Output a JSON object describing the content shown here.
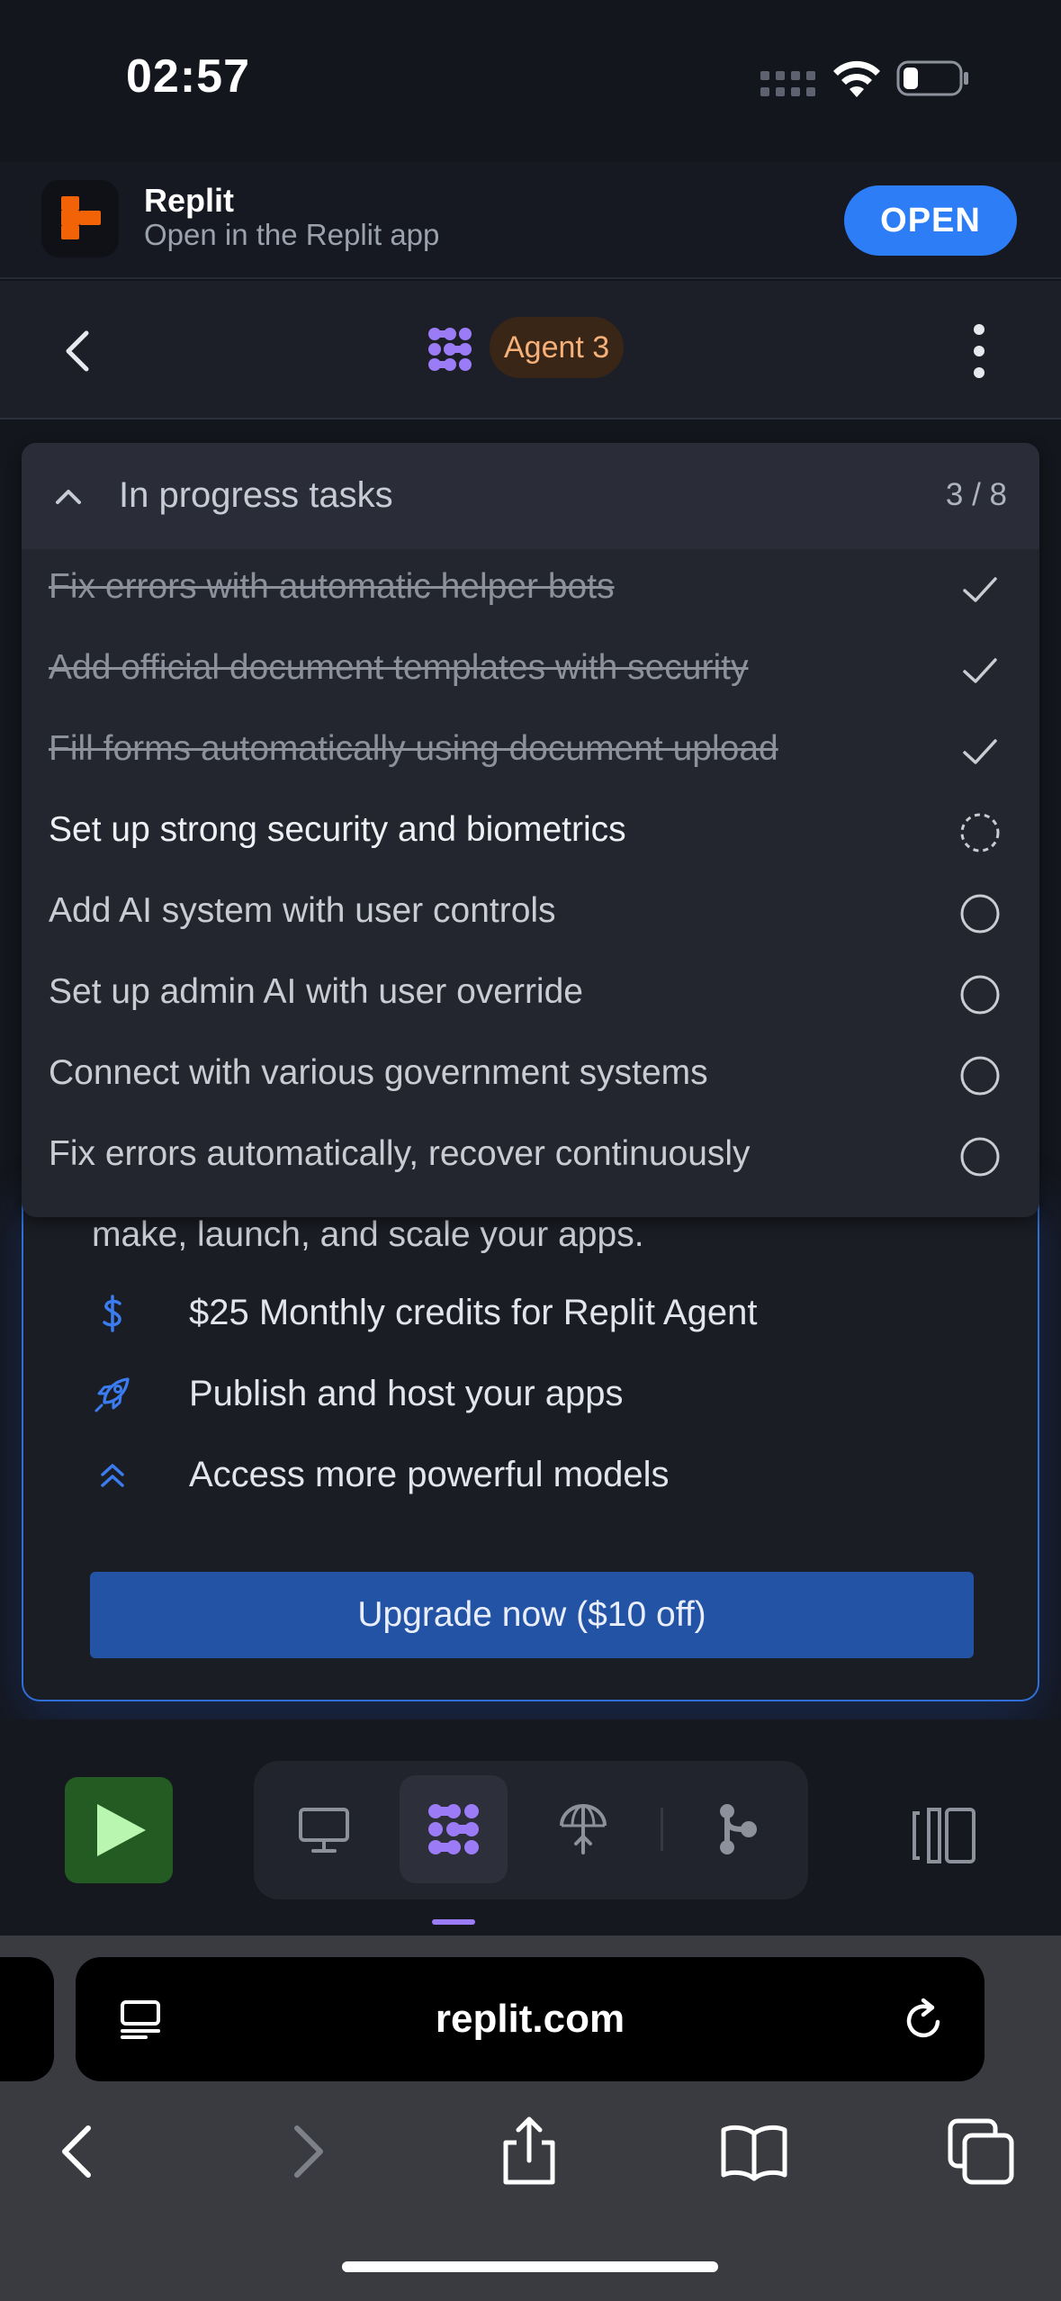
{
  "status_bar": {
    "time": "02:57"
  },
  "banner": {
    "app_name": "Replit",
    "subtitle": "Open in the Replit app",
    "open_label": "OPEN"
  },
  "header": {
    "agent_label": "Agent 3"
  },
  "tasks": {
    "title": "In progress tasks",
    "count": "3 / 8",
    "items": [
      {
        "label": "Fix errors with automatic helper bots",
        "status": "done"
      },
      {
        "label": "Add official document templates with security",
        "status": "done"
      },
      {
        "label": "Fill forms automatically using document upload",
        "status": "done"
      },
      {
        "label": "Set up strong security and biometrics",
        "status": "in-progress"
      },
      {
        "label": "Add AI system with user controls",
        "status": "pending"
      },
      {
        "label": "Set up admin AI with user override",
        "status": "pending"
      },
      {
        "label": "Connect with various government systems",
        "status": "pending"
      },
      {
        "label": "Fix errors automatically, recover continuously",
        "status": "pending"
      }
    ]
  },
  "promo": {
    "text": "make, launch, and scale your apps.",
    "features": [
      {
        "icon": "dollar-icon",
        "label": "$25 Monthly credits for Replit Agent"
      },
      {
        "icon": "rocket-icon",
        "label": "Publish and host your apps"
      },
      {
        "icon": "double-chevron-up-icon",
        "label": "Access more powerful models"
      }
    ],
    "upgrade_label": "Upgrade now ($10 off)"
  },
  "toolbar": {
    "tabs": [
      "preview-icon",
      "agent-icon",
      "deploy-icon",
      "git-icon"
    ],
    "active_tab": "agent-icon"
  },
  "browser": {
    "url": "replit.com"
  },
  "colors": {
    "accent": "#2c7df6",
    "agent_purple": "#9c7cf6",
    "badge_orange": "#f6b17a",
    "run_green": "#245b22"
  }
}
